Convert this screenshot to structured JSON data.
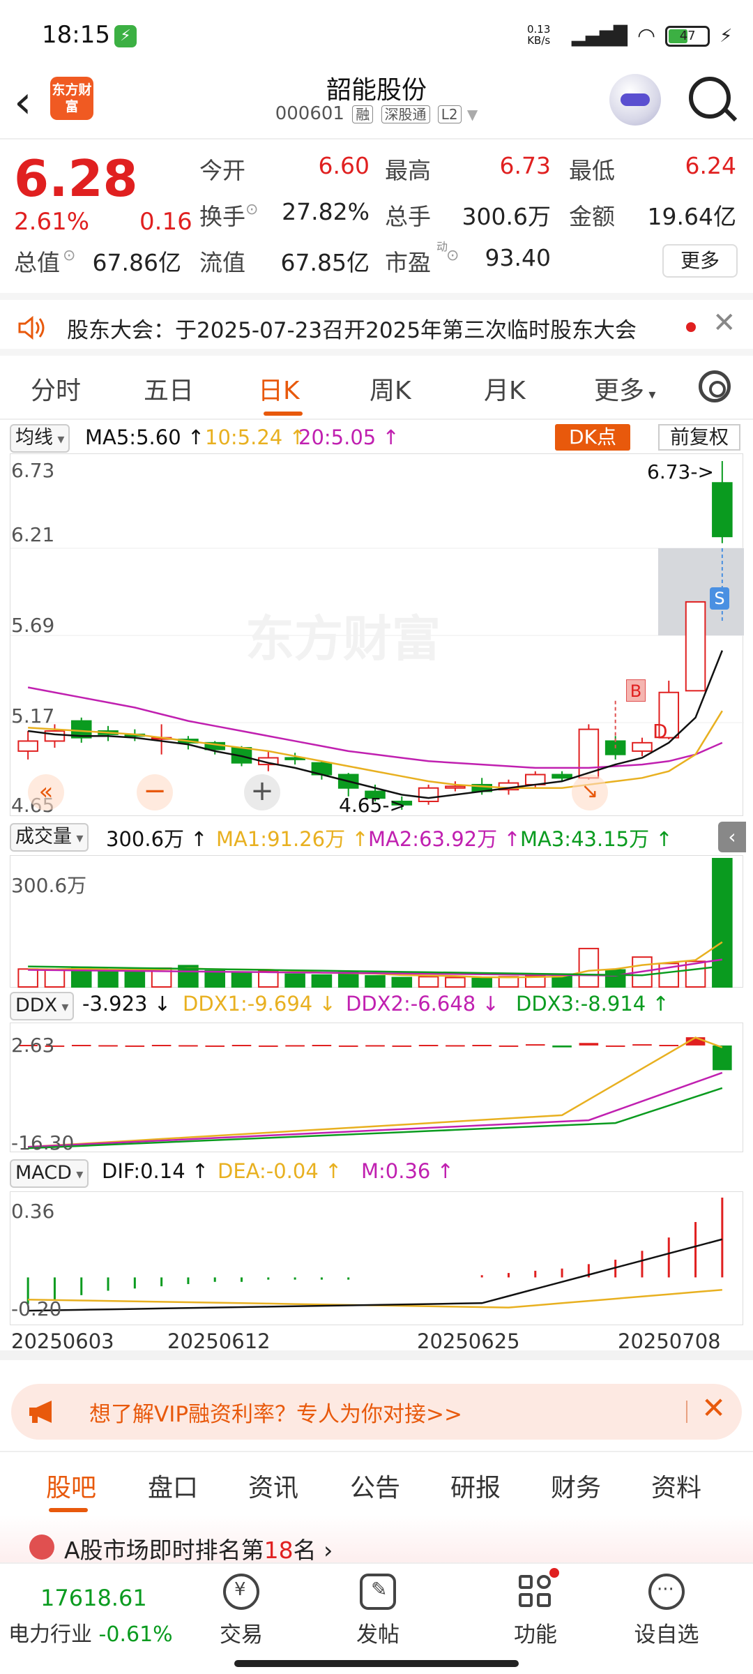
{
  "status_bar": {
    "time": "18:15",
    "network_speed": "0.13",
    "network_unit": "KB/s",
    "battery": "47"
  },
  "header": {
    "title": "韶能股份",
    "code": "000601",
    "tags": [
      "融",
      "深股通",
      "L2"
    ],
    "logo_text": "东方财富"
  },
  "quote": {
    "price": "6.28",
    "change_pct": "2.61%",
    "change": "0.16",
    "fields": [
      {
        "label": "今开",
        "value": "6.60",
        "color": "red"
      },
      {
        "label": "最高",
        "value": "6.73",
        "color": "red"
      },
      {
        "label": "最低",
        "value": "6.24",
        "color": "red"
      },
      {
        "label": "换手",
        "value": "27.82%",
        "color": "normal"
      },
      {
        "label": "总手",
        "value": "300.6万",
        "color": "normal"
      },
      {
        "label": "金额",
        "value": "19.64亿",
        "color": "normal"
      },
      {
        "label": "总值",
        "value": "67.86亿",
        "color": "normal"
      },
      {
        "label": "流值",
        "value": "67.85亿",
        "color": "normal"
      },
      {
        "label": "市盈",
        "value": "93.40",
        "color": "normal"
      }
    ],
    "more_label": "更多",
    "pe_superscript": "动"
  },
  "notice": {
    "text": "股东大会：于2025-07-23召开2025年第三次临时股东大会"
  },
  "period_tabs": [
    "分时",
    "五日",
    "日K",
    "周K",
    "月K",
    "更多"
  ],
  "active_period": "日K",
  "ma_legend": {
    "selector": "均线",
    "ma5": "MA5:5.60 ↑",
    "ma10": "10:5.24 ↑",
    "ma20": "20:5.05 ↑",
    "dk_label": "DK点",
    "adjust_label": "前复权"
  },
  "kline": {
    "y_labels": [
      "6.73",
      "6.21",
      "5.69",
      "5.17",
      "4.65"
    ],
    "high_marker": "6.73->",
    "low_marker": "4.65->",
    "buy_marker": "B",
    "sell_marker": "S",
    "d_marker": "D",
    "watermark": "东方财富"
  },
  "volume_legend": {
    "selector": "成交量",
    "vol": "300.6万 ↑",
    "ma1": "MA1:91.26万 ↑",
    "ma2": "MA2:63.92万 ↑",
    "ma3": "MA3:43.15万 ↑",
    "y_top": "300.6万"
  },
  "ddx_legend": {
    "selector": "DDX",
    "ddx": "-3.923 ↓",
    "ddx1": "DDX1:-9.694 ↓",
    "ddx2": "DDX2:-6.648 ↓",
    "ddx3": "DDX3:-8.914 ↑",
    "y_top": "2.63",
    "y_bottom": "-16.30"
  },
  "macd_legend": {
    "selector": "MACD",
    "dif": "DIF:0.14 ↑",
    "dea": "DEA:-0.04 ↑",
    "m": "M:0.36 ↑",
    "y_top": "0.36",
    "y_bottom": "-0.20"
  },
  "dates": [
    "20250603",
    "20250612",
    "20250625",
    "20250708"
  ],
  "vip_banner": {
    "text": "想了解VIP融资利率？专人为你对接>>"
  },
  "sub_tabs": [
    "股吧",
    "盘口",
    "资讯",
    "公告",
    "研报",
    "财务",
    "资料"
  ],
  "rank": {
    "prefix": "A股市场即时排名第",
    "rank": "18",
    "suffix": "名"
  },
  "bottom_nav": {
    "index_value": "17618.61",
    "industry": "电力行业",
    "industry_change": "-0.61%",
    "items": [
      "交易",
      "发帖",
      "功能",
      "设自选"
    ]
  },
  "colors": {
    "up": "#e02020",
    "down": "#0a9b1f",
    "accent": "#e8590c",
    "ma5": "#111111",
    "ma10": "#e8b020",
    "ma20": "#c020b0"
  },
  "chart_data": {
    "type": "candlestick",
    "ylim": [
      4.65,
      6.73
    ],
    "candles": [
      {
        "o": 5.0,
        "c": 5.06,
        "h": 5.12,
        "l": 4.95
      },
      {
        "o": 5.06,
        "c": 5.12,
        "h": 5.16,
        "l": 5.02
      },
      {
        "o": 5.18,
        "c": 5.08,
        "h": 5.2,
        "l": 5.05
      },
      {
        "o": 5.12,
        "c": 5.1,
        "h": 5.15,
        "l": 5.06
      },
      {
        "o": 5.1,
        "c": 5.09,
        "h": 5.13,
        "l": 5.06
      },
      {
        "o": 5.08,
        "c": 5.08,
        "h": 5.16,
        "l": 4.98
      },
      {
        "o": 5.07,
        "c": 5.05,
        "h": 5.09,
        "l": 5.01
      },
      {
        "o": 5.05,
        "c": 5.01,
        "h": 5.06,
        "l": 4.98
      },
      {
        "o": 5.02,
        "c": 4.93,
        "h": 5.03,
        "l": 4.91
      },
      {
        "o": 4.92,
        "c": 4.96,
        "h": 5.0,
        "l": 4.88
      },
      {
        "o": 4.96,
        "c": 4.95,
        "h": 4.99,
        "l": 4.92
      },
      {
        "o": 4.93,
        "c": 4.86,
        "h": 4.94,
        "l": 4.83
      },
      {
        "o": 4.86,
        "c": 4.78,
        "h": 4.87,
        "l": 4.73
      },
      {
        "o": 4.76,
        "c": 4.72,
        "h": 4.8,
        "l": 4.7
      },
      {
        "o": 4.7,
        "c": 4.68,
        "h": 4.73,
        "l": 4.65
      },
      {
        "o": 4.7,
        "c": 4.78,
        "h": 4.8,
        "l": 4.68
      },
      {
        "o": 4.78,
        "c": 4.79,
        "h": 4.82,
        "l": 4.76
      },
      {
        "o": 4.8,
        "c": 4.76,
        "h": 4.84,
        "l": 4.74
      },
      {
        "o": 4.77,
        "c": 4.81,
        "h": 4.83,
        "l": 4.74
      },
      {
        "o": 4.8,
        "c": 4.86,
        "h": 4.88,
        "l": 4.78
      },
      {
        "o": 4.86,
        "c": 4.84,
        "h": 4.88,
        "l": 4.82
      },
      {
        "o": 4.84,
        "c": 5.13,
        "h": 5.16,
        "l": 4.83
      },
      {
        "o": 5.06,
        "c": 4.98,
        "h": 5.09,
        "l": 4.95
      },
      {
        "o": 5.0,
        "c": 5.05,
        "h": 5.08,
        "l": 4.97
      },
      {
        "o": 5.08,
        "c": 5.35,
        "h": 5.42,
        "l": 5.07
      },
      {
        "o": 5.36,
        "c": 5.89,
        "h": 5.89,
        "l": 5.36
      },
      {
        "o": 6.6,
        "c": 6.28,
        "h": 6.73,
        "l": 6.24
      }
    ],
    "ma5": [
      5.12,
      5.1,
      5.09,
      5.09,
      5.08,
      5.06,
      5.04,
      5.0,
      4.97,
      4.93,
      4.9,
      4.86,
      4.82,
      4.78,
      4.74,
      4.72,
      4.74,
      4.76,
      4.78,
      4.8,
      4.82,
      4.87,
      4.92,
      4.96,
      5.05,
      5.2,
      5.6
    ],
    "ma10": [
      5.14,
      5.13,
      5.12,
      5.11,
      5.1,
      5.08,
      5.06,
      5.04,
      5.02,
      5.0,
      4.97,
      4.94,
      4.91,
      4.88,
      4.85,
      4.82,
      4.8,
      4.79,
      4.78,
      4.78,
      4.78,
      4.8,
      4.82,
      4.84,
      4.88,
      4.98,
      5.24
    ],
    "ma20": [
      5.38,
      5.35,
      5.32,
      5.29,
      5.26,
      5.22,
      5.18,
      5.15,
      5.12,
      5.09,
      5.06,
      5.03,
      5.0,
      4.98,
      4.96,
      4.94,
      4.93,
      4.92,
      4.91,
      4.9,
      4.9,
      4.9,
      4.91,
      4.92,
      4.94,
      4.98,
      5.05
    ],
    "volume": [
      42,
      40,
      46,
      36,
      40,
      44,
      50,
      38,
      32,
      38,
      30,
      28,
      34,
      26,
      22,
      24,
      22,
      20,
      24,
      26,
      30,
      90,
      40,
      70,
      55,
      60,
      300.6
    ],
    "volume_ylim": [
      0,
      300.6
    ],
    "ddx_ylim": [
      -16.3,
      2.63
    ],
    "macd_ylim": [
      -0.2,
      0.36
    ],
    "dates": [
      "20250603",
      "20250612",
      "20250625",
      "20250708"
    ]
  }
}
